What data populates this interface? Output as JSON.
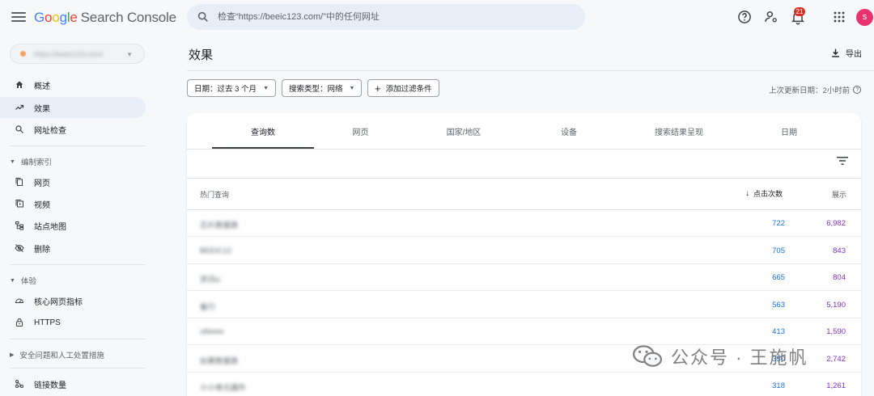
{
  "app": {
    "logo_letters": [
      "G",
      "o",
      "o",
      "g",
      "l",
      "e"
    ],
    "logo_rest": "Search Console"
  },
  "search": {
    "placeholder": "检查“https://beeic123.com/”中的任何网址"
  },
  "notifications": {
    "count": "21"
  },
  "user": {
    "initial": "s"
  },
  "property": {
    "label": "https://beeic123.com/"
  },
  "sidebar": {
    "items": [
      {
        "label": "概述",
        "icon": "home-icon"
      },
      {
        "label": "效果",
        "icon": "trending-up-icon"
      },
      {
        "label": "网址检查",
        "icon": "search-icon"
      }
    ],
    "sections": [
      {
        "title": "编制索引",
        "items": [
          {
            "label": "网页",
            "icon": "pages-icon"
          },
          {
            "label": "视频",
            "icon": "video-icon"
          },
          {
            "label": "站点地图",
            "icon": "sitemap-icon"
          },
          {
            "label": "删除",
            "icon": "visibility-off-icon"
          }
        ]
      },
      {
        "title": "体验",
        "items": [
          {
            "label": "核心网页指标",
            "icon": "speed-icon"
          },
          {
            "label": "HTTPS",
            "icon": "lock-icon"
          }
        ]
      },
      {
        "title": "安全问题和人工处置措施",
        "items": []
      }
    ],
    "bottom_items": [
      {
        "label": "链接数量",
        "icon": "links-icon"
      }
    ]
  },
  "main": {
    "title": "效果",
    "export_label": "导出",
    "filters": {
      "date": "日期：过去 3 个月",
      "search_type": "搜索类型：网络",
      "add_filter": "添加过滤条件"
    },
    "last_updated": "上次更新日期：2小时前",
    "tabs": [
      "查询数",
      "网页",
      "国家/地区",
      "设备",
      "搜索结果呈现",
      "日期"
    ],
    "active_tab": 0,
    "table": {
      "headers": {
        "query": "热门查询",
        "clicks": "点击次数",
        "impressions": "展示"
      },
      "rows": [
        {
          "query": "芯片数据表",
          "clicks": "722",
          "impressions": "6,982"
        },
        {
          "query": "BEEIC12",
          "clicks": "705",
          "impressions": "843"
        },
        {
          "query": "资讯ic",
          "clicks": "665",
          "impressions": "804"
        },
        {
          "query": "备行",
          "clicks": "563",
          "impressions": "5,190"
        },
        {
          "query": "ulbeeic",
          "clicks": "413",
          "impressions": "1,590"
        },
        {
          "query": "如果数据表",
          "clicks": "350",
          "impressions": "2,742"
        },
        {
          "query": "小小单元器件",
          "clicks": "318",
          "impressions": "1,261"
        }
      ]
    }
  },
  "watermark": {
    "text": "公众号 · 王施帆"
  },
  "colors": {
    "accent": "#1a73e8",
    "impressions": "#8430ce",
    "active_nav": "#e8eef7",
    "badge": "#d93025",
    "avatar": "#e8336f"
  }
}
